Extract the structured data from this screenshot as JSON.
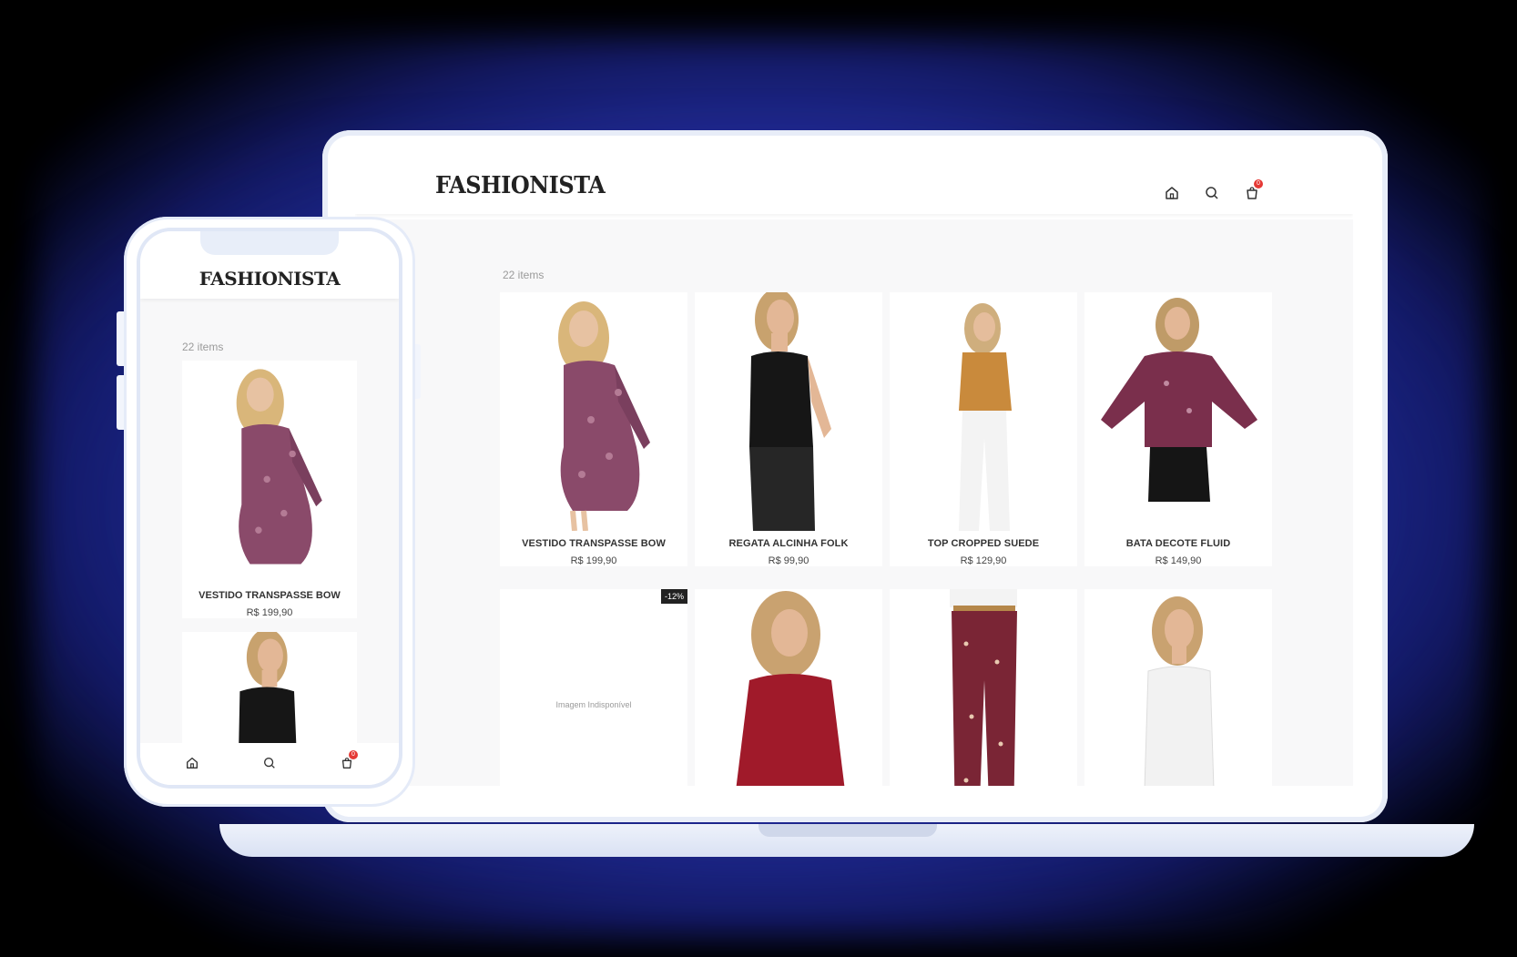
{
  "desktop": {
    "brand": "FASHIONISTA",
    "nav": {
      "home_icon": "home-icon",
      "search_icon": "search-icon",
      "cart_icon": "cart-icon",
      "cart_count": "0"
    },
    "items_count": "22 items",
    "products": [
      {
        "name": "VESTIDO TRANSPASSE BOW",
        "price": "R$ 199,90"
      },
      {
        "name": "REGATA ALCINHA FOLK",
        "price": "R$ 99,90"
      },
      {
        "name": "TOP CROPPED SUEDE",
        "price": "R$ 129,90"
      },
      {
        "name": "BATA DECOTE FLUID",
        "price": "R$ 149,90"
      }
    ],
    "row2": {
      "discount_badge": "-12%",
      "unavailable_text": "Imagem Indisponível"
    }
  },
  "mobile": {
    "brand": "FASHIONISTA",
    "items_count": "22 items",
    "products": [
      {
        "name": "VESTIDO TRANSPASSE BOW",
        "price": "R$ 199,90"
      }
    ],
    "cart_count": "0"
  },
  "colors": {
    "glow": "#2a36b8",
    "badge": "#e53935",
    "dress_print": "#8a4a6a",
    "red_shirt": "#a01a2a",
    "mustard_top": "#c98a3c"
  }
}
